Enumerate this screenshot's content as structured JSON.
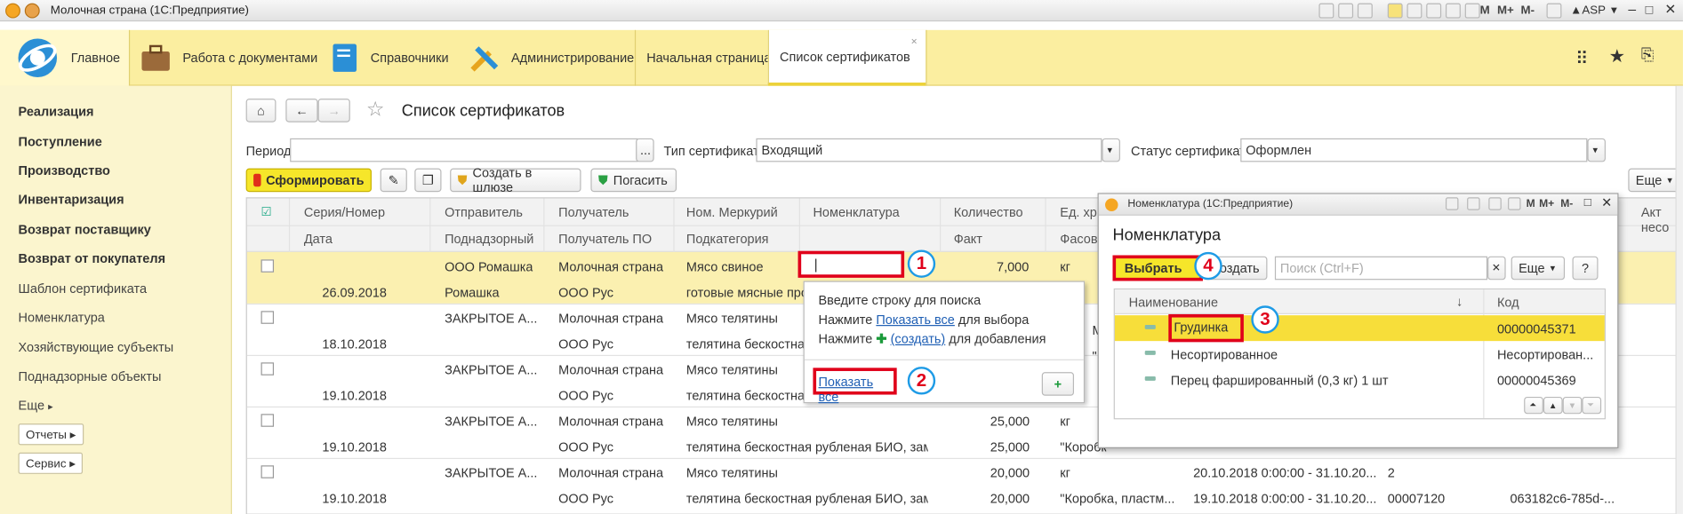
{
  "titlebar": {
    "title": "Молочная страна  (1С:Предприятие)",
    "user": "ASP",
    "m1": "M",
    "m2": "M+",
    "m3": "M-"
  },
  "sections": {
    "main": "Главное",
    "docs": "Работа с документами",
    "refs": "Справочники",
    "admin": "Администрирование",
    "tab_home": "Начальная страница",
    "tab_certs": "Список сертификатов"
  },
  "sidebar": {
    "bold": [
      "Реализация",
      "Поступление",
      "Производство",
      "Инвентаризация",
      "Возврат поставщику",
      "Возврат от покупателя"
    ],
    "normal": [
      "Шаблон сертификата",
      "Номенклатура",
      "Хозяйствующие субъекты",
      "Поднадзорные объекты"
    ],
    "more": "Еще",
    "reports": "Отчеты",
    "service": "Сервис"
  },
  "page": {
    "title": "Список сертификатов",
    "period_label": "Период:",
    "period_value": "",
    "period_dots": "...",
    "type_label": "Тип сертификата:",
    "type_value": "Входящий",
    "status_label": "Статус сертификата:",
    "status_value": "Оформлен",
    "btn_form": "Сформировать",
    "btn_create_gateway": "Создать в шлюзе",
    "btn_repay": "Погасить",
    "btn_more": "Еще"
  },
  "grid": {
    "headers_top": [
      "Серия/Номер",
      "Отправитель",
      "Получатель",
      "Ном. Меркурий",
      "Номенклатура",
      "Количество",
      "Ед. хр"
    ],
    "headers_bottom": [
      "Дата",
      "Поднадзорный",
      "Получатель ПО",
      "Подкатегория",
      "",
      "Факт",
      "Фасов"
    ],
    "right_hdr1": "Акт",
    "right_hdr2": "несо",
    "rows": [
      {
        "date": "",
        "sender": "ООО Ромашка",
        "receiver": "Молочная страна",
        "merc": "Мясо свиное",
        "qty": "7,000",
        "unit": "кг"
      },
      {
        "date": "26.09.2018",
        "sender": "Ромашка",
        "receiver": "ООО Рус",
        "merc": "готовые мясные прод",
        "qty": "",
        "unit": ""
      },
      {
        "date": "",
        "sender": "ЗАКРЫТОЕ А...",
        "receiver": "Молочная страна",
        "merc": "Мясо телятины",
        "qty": "",
        "unit": ""
      },
      {
        "date": "18.10.2018",
        "sender": "",
        "receiver": "ООО Рус",
        "merc": "телятина бескостная р",
        "qty": "",
        "unit": ""
      },
      {
        "date": "",
        "sender": "ЗАКРЫТОЕ А...",
        "receiver": "Молочная страна",
        "merc": "Мясо телятины",
        "qty": "",
        "unit": ""
      },
      {
        "date": "19.10.2018",
        "sender": "",
        "receiver": "ООО Рус",
        "merc": "телятина бескостная р",
        "qty": "",
        "unit": ""
      },
      {
        "date": "",
        "sender": "ЗАКРЫТОЕ А...",
        "receiver": "Молочная страна",
        "merc": "Мясо телятины",
        "qty": "25,000",
        "unit": "кг"
      },
      {
        "date": "19.10.2018",
        "sender": "",
        "receiver": "ООО Рус",
        "merc": "телятина бескостная рубленая БИО, замо...",
        "qty": "25,000",
        "unit": "\"Коробк"
      },
      {
        "date": "",
        "sender": "ЗАКРЫТОЕ А...",
        "receiver": "Молочная страна",
        "merc": "Мясо телятины",
        "qty": "20,000",
        "unit": "кг"
      },
      {
        "date": "19.10.2018",
        "sender": "",
        "receiver": "ООО Рус",
        "merc": "телятина бескостная рубленая БИО, замо...",
        "qty": "20,000",
        "unit": "\"Коробка, пластм..."
      }
    ],
    "extra_row9": {
      "period": "20.10.2018 0:00:00 - 31.10.20...",
      "n": "2"
    },
    "extra_row10": {
      "period": "19.10.2018 0:00:00 - 31.10.20...",
      "code": "00007120",
      "guid": "063182c6-785d-..."
    },
    "side_m": "M",
    "side_m2": "\"I"
  },
  "popup": {
    "line1": "Введите строку для поиска",
    "line2_pre": "Нажмите ",
    "line2_link": "Показать все",
    "line2_post": " для выбора",
    "line3_pre": "Нажмите ",
    "line3_link": "(создать)",
    "line3_post": " для добавления",
    "show_all": "Показать все",
    "plus": "+"
  },
  "dialog": {
    "window_title": "Номенклатура  (1С:Предприятие)",
    "heading": "Номенклатура",
    "btn_select": "Выбрать",
    "btn_create": "Создать",
    "search_placeholder": "Поиск (Ctrl+F)",
    "btn_more": "Еще",
    "btn_help": "?",
    "col_name": "Наименование",
    "col_code": "Код",
    "sort_arrow": "↓",
    "rows": [
      {
        "name": "Грудинка",
        "code": "00000045371"
      },
      {
        "name": "Несортированное",
        "code": "Несортирован..."
      },
      {
        "name": "Перец фаршированный (0,3 кг) 1 шт",
        "code": "00000045369"
      }
    ]
  },
  "markers": [
    "1",
    "2",
    "3",
    "4"
  ]
}
